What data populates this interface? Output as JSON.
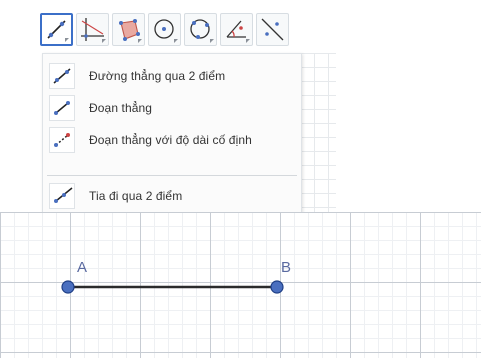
{
  "toolbar": {
    "tools": [
      {
        "icon": "line-through-two-points-icon",
        "active": true
      },
      {
        "icon": "perpendicular-line-icon",
        "active": false
      },
      {
        "icon": "polygon-icon",
        "active": false
      },
      {
        "icon": "circle-center-point-icon",
        "active": false
      },
      {
        "icon": "circle-three-points-icon",
        "active": false
      },
      {
        "icon": "angle-icon",
        "active": false
      },
      {
        "icon": "reflect-about-line-icon",
        "active": false
      }
    ]
  },
  "menu": {
    "items": [
      {
        "label": "Đường thẳng qua 2 điểm",
        "icon": "line-through-two-points-icon"
      },
      {
        "label": "Đoạn thẳng",
        "icon": "segment-icon"
      },
      {
        "label": "Đoạn thẳng với độ dài cố định",
        "icon": "segment-fixed-length-icon"
      },
      {
        "label": "Tia đi qua 2 điểm",
        "icon": "ray-icon"
      }
    ]
  },
  "canvas": {
    "points": [
      {
        "label": "A"
      },
      {
        "label": "B"
      }
    ],
    "colors": {
      "point_fill": "#4a6fbf",
      "point_stroke": "#1f3f86",
      "segment": "#2b2b2b",
      "active_border": "#3b6fc8"
    }
  }
}
